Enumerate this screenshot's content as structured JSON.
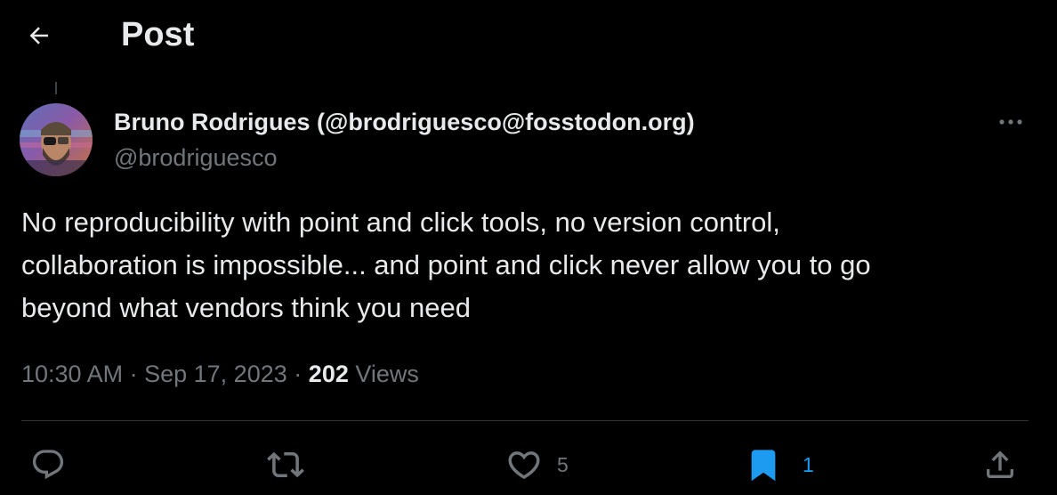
{
  "header": {
    "title": "Post",
    "back_icon": "arrow-left-icon"
  },
  "author": {
    "name": "Bruno Rodrigues (@brodriguesco@fosstodon.org)",
    "handle": "@brodriguesco"
  },
  "post": {
    "text": "No reproducibility with point and click tools, no version control,\ncollaboration is impossible... and point and click never allow you to go\nbeyond what vendors think you need",
    "time": "10:30 AM",
    "separator": "·",
    "date": "Sep 17, 2023",
    "views_count": "202",
    "views_label": "Views"
  },
  "actions": {
    "reply_icon": "reply-icon",
    "repost_icon": "repost-icon",
    "like_icon": "heart-icon",
    "like_count": "5",
    "bookmark_icon": "bookmark-icon",
    "bookmark_count": "1",
    "share_icon": "share-icon"
  },
  "colors": {
    "background": "#000000",
    "primary_text": "#e7e9ea",
    "secondary_text": "#71767b",
    "accent": "#1d9bf0",
    "divider": "#2f3336"
  }
}
